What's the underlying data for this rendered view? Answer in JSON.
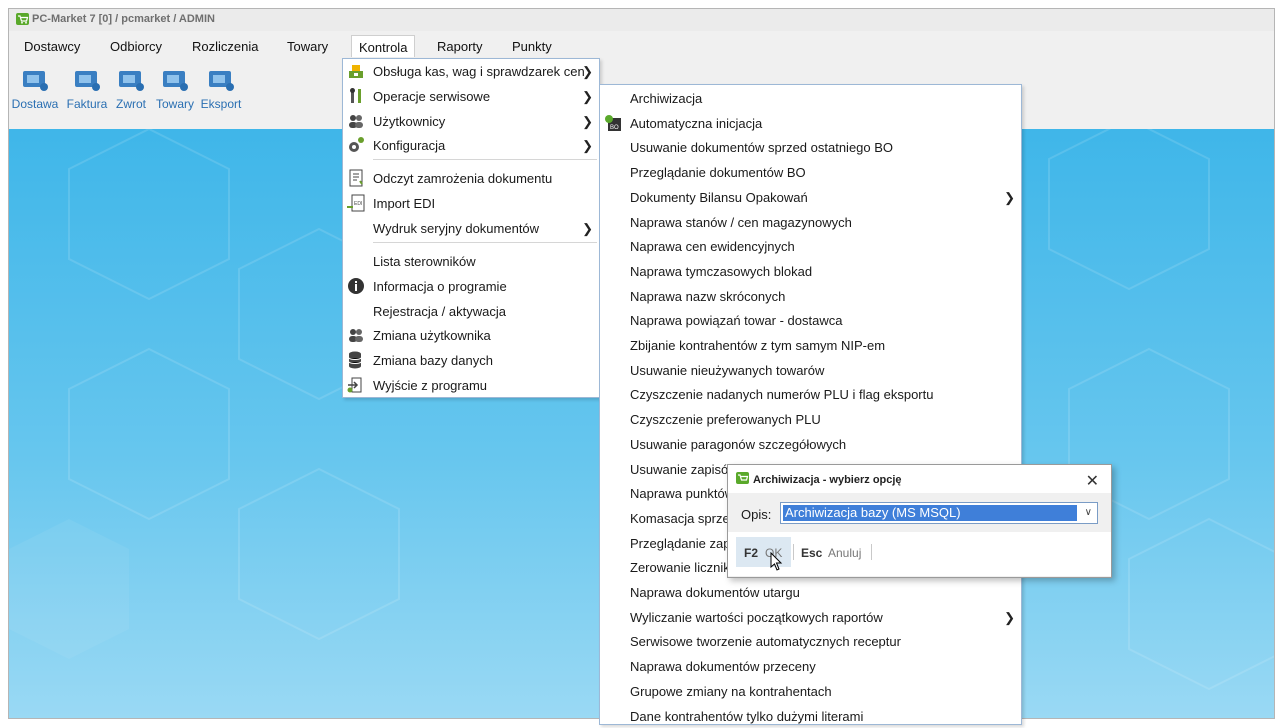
{
  "window": {
    "title": "PC-Market 7 [0] / pcmarket / ADMIN"
  },
  "menubar": [
    "Dostawcy",
    "Odbiorcy",
    "Rozliczenia",
    "Towary",
    "Kontrola",
    "Raporty",
    "Punkty"
  ],
  "toolbar": [
    "Dostawa",
    "Faktura",
    "Zwrot",
    "Towary",
    "Eksport"
  ],
  "menu1": {
    "items": [
      {
        "label": "Obsługa kas, wag i sprawdzarek cen",
        "submenu": true,
        "icon": "scale-icon"
      },
      {
        "label": "Operacje serwisowe",
        "submenu": true,
        "icon": "tools-icon"
      },
      {
        "label": "Użytkownicy",
        "submenu": true,
        "icon": "users-icon"
      },
      {
        "label": "Konfiguracja",
        "submenu": true,
        "icon": "gears-icon"
      },
      {
        "label": "Odczyt zamrożenia dokumentu",
        "submenu": false,
        "icon": "document-freeze-icon"
      },
      {
        "label": "Import EDI",
        "submenu": false,
        "icon": "edi-import-icon"
      },
      {
        "label": "Wydruk seryjny dokumentów",
        "submenu": true,
        "icon": ""
      },
      {
        "label": "Lista sterowników",
        "submenu": false,
        "icon": ""
      },
      {
        "label": "Informacja o programie",
        "submenu": false,
        "icon": "info-icon"
      },
      {
        "label": "Rejestracja / aktywacja",
        "submenu": false,
        "icon": ""
      },
      {
        "label": "Zmiana użytkownika",
        "submenu": false,
        "icon": "user-switch-icon"
      },
      {
        "label": "Zmiana bazy danych",
        "submenu": false,
        "icon": "database-icon"
      },
      {
        "label": "Wyjście z programu",
        "submenu": false,
        "icon": "exit-icon"
      }
    ]
  },
  "menu2": {
    "items": [
      {
        "label": "Archiwizacja",
        "submenu": false
      },
      {
        "label": "Automatyczna inicjacja",
        "submenu": false,
        "icon": "bo-icon"
      },
      {
        "label": "Usuwanie dokumentów sprzed ostatniego BO",
        "submenu": false
      },
      {
        "label": "Przeglądanie dokumentów BO",
        "submenu": false
      },
      {
        "label": "Dokumenty Bilansu Opakowań",
        "submenu": true
      },
      {
        "label": "Naprawa stanów / cen magazynowych",
        "submenu": false
      },
      {
        "label": "Naprawa cen ewidencyjnych",
        "submenu": false
      },
      {
        "label": "Naprawa tymczasowych blokad",
        "submenu": false
      },
      {
        "label": "Naprawa nazw skróconych",
        "submenu": false
      },
      {
        "label": "Naprawa powiązań towar - dostawca",
        "submenu": false
      },
      {
        "label": "Zbijanie kontrahentów z tym samym NIP-em",
        "submenu": false
      },
      {
        "label": "Usuwanie nieużywanych towarów",
        "submenu": false
      },
      {
        "label": "Czyszczenie nadanych numerów PLU i flag eksportu",
        "submenu": false
      },
      {
        "label": "Czyszczenie preferowanych PLU",
        "submenu": false
      },
      {
        "label": "Usuwanie paragonów szczegółowych",
        "submenu": false
      },
      {
        "label": "Usuwanie zapisów",
        "submenu": false
      },
      {
        "label": "Naprawa punktów",
        "submenu": false
      },
      {
        "label": "Komasacja sprze",
        "submenu": false
      },
      {
        "label": "Przeglądanie zapi",
        "submenu": false
      },
      {
        "label": "Zerowanie licznik",
        "submenu": false
      },
      {
        "label": "Naprawa dokumentów utargu",
        "submenu": false
      },
      {
        "label": "Wyliczanie wartości początkowych  raportów",
        "submenu": true
      },
      {
        "label": "Serwisowe tworzenie automatycznych receptur",
        "submenu": false
      },
      {
        "label": "Naprawa dokumentów przeceny",
        "submenu": false
      },
      {
        "label": "Grupowe zmiany na kontrahentach",
        "submenu": false
      },
      {
        "label": "Dane kontrahentów tylko dużymi literami",
        "submenu": false
      }
    ]
  },
  "dialog": {
    "title": "Archiwizacja - wybierz opcję",
    "close": "✕",
    "opis_label": "Opis:",
    "selected_option": "Archiwizacja bazy (MS MSQL)",
    "ok_key": "F2",
    "ok_label": "OK",
    "cancel_key": "Esc",
    "cancel_label": "Anuluj"
  }
}
